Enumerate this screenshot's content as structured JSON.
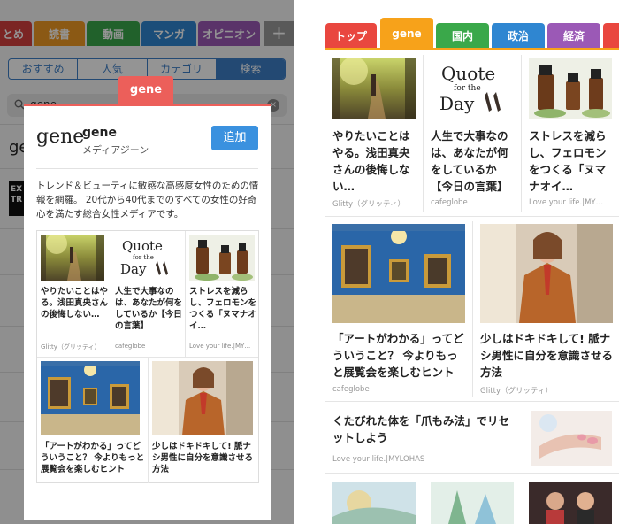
{
  "left": {
    "tabs": [
      {
        "label": "とめ",
        "color": "#d4413f"
      },
      {
        "label": "読書",
        "color": "#f09a24"
      },
      {
        "label": "動画",
        "color": "#3aa84a"
      },
      {
        "label": "マンガ",
        "color": "#2f86d1"
      },
      {
        "label": "オピニオン",
        "color": "#9b59b6"
      }
    ],
    "plus_label": "+",
    "segments": [
      {
        "label": "おすすめ",
        "active": false
      },
      {
        "label": "人気",
        "active": false
      },
      {
        "label": "カテゴリ",
        "active": false
      },
      {
        "label": "検索",
        "active": true
      }
    ],
    "search_value": "gene",
    "bg_result": "ge",
    "bg_thumb_text": "EX TR",
    "popup": {
      "tab_label": "gene",
      "logo": "gene",
      "name": "gene",
      "subtitle": "メディアジーン",
      "add_button": "追加",
      "description": "トレンド＆ビューティに敏感な高感度女性のための情報を網羅。 20代から40代までのすべての女性の好奇心を満たす総合女性メディアです。",
      "articles": [
        {
          "title": "やりたいことはやる。浅田真央さんの後悔しない…",
          "source": "Glitty（グリッティ）"
        },
        {
          "title": "人生で大事なのは、あなたが何をしているか【今日の言葉】",
          "source": "cafeglobe"
        },
        {
          "title": "ストレスを減らし、フェロモンをつくる「ヌマナオイ…",
          "source": "Love your life.|MY…"
        },
        {
          "title": "「アートがわかる」ってどういうこと？ 今よりもっと展覧会を楽しむヒント",
          "source": ""
        },
        {
          "title": "少しはドキドキして! 脈ナシ男性に自分を意識させる方法",
          "source": ""
        }
      ]
    }
  },
  "right": {
    "tabs": [
      {
        "label": "トップ",
        "color": "#e9473f"
      },
      {
        "label": "gene",
        "color": "#f7a21a",
        "active": true
      },
      {
        "label": "国内",
        "color": "#3aa84a"
      },
      {
        "label": "政治",
        "color": "#2f86d1"
      },
      {
        "label": "経済",
        "color": "#9b59b6"
      },
      {
        "label": "",
        "color": "#e9473f"
      }
    ],
    "row1": [
      {
        "title": "やりたいことはやる。浅田真央さんの後悔しない…",
        "source": "Glitty（グリッティ）"
      },
      {
        "title": "人生で大事なのは、あなたが何をしているか【今日の言葉】",
        "source": "cafeglobe"
      },
      {
        "title": "ストレスを減らし、フェロモンをつくる「ヌマナオイ…",
        "source": "Love your life.|MY…"
      }
    ],
    "row2": [
      {
        "title": "「アートがわかる」ってどういうこと？ 今よりもっと展覧会を楽しむヒント",
        "source": "cafeglobe"
      },
      {
        "title": "少しはドキドキして! 脈ナシ男性に自分を意識させる方法",
        "source": "Glitty（グリッティ）"
      }
    ],
    "row3": {
      "title": "くたびれた体を「爪もみ法」でリセットしよう",
      "source": "Love your life.|MYLOHAS"
    }
  },
  "quote_image": {
    "line1": "Quote",
    "line2": "for the",
    "line3": "Day"
  }
}
